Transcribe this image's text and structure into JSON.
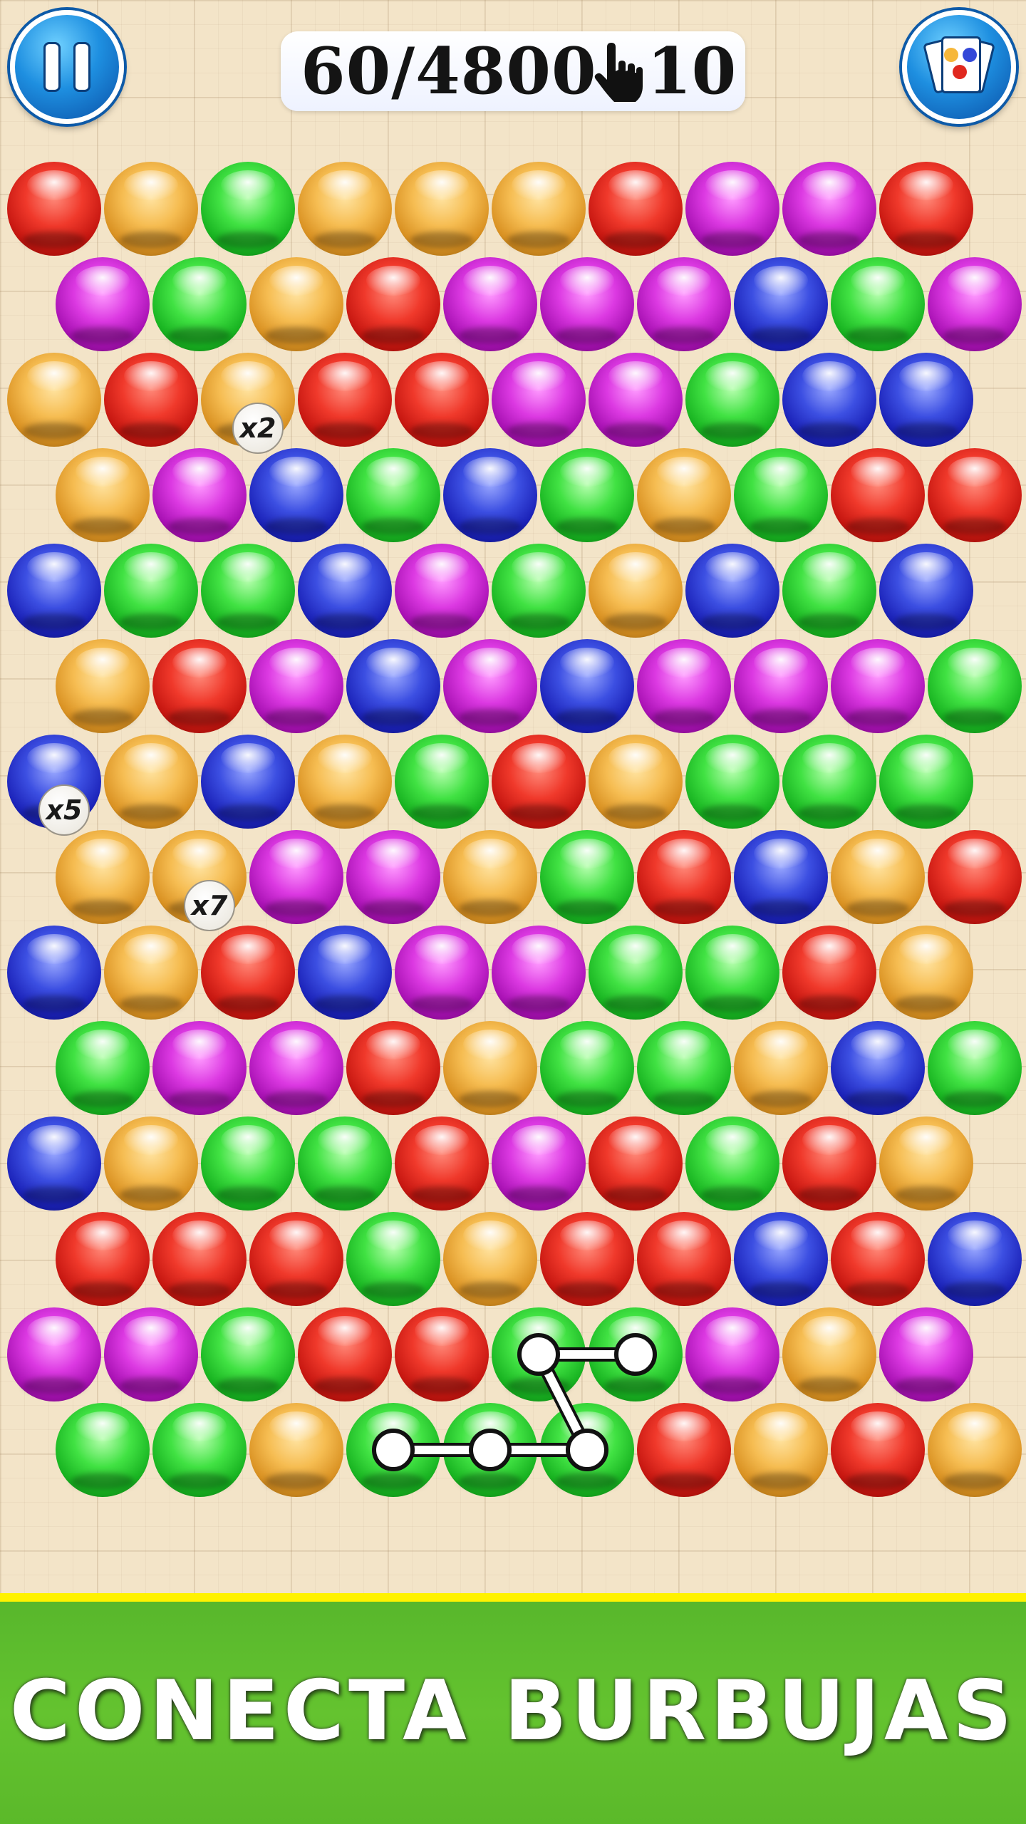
{
  "hud": {
    "score": "60/4800",
    "moves": "10",
    "pause_icon": "pause-icon",
    "hand_icon": "hand-pointer-icon",
    "cards_icon": "color-cards-icon"
  },
  "board": {
    "rows": [
      [
        "red",
        "orange",
        "green",
        "orange",
        "orange",
        "orange",
        "red",
        "purple",
        "purple",
        "red"
      ],
      [
        "purple",
        "green",
        "orange",
        "red",
        "purple",
        "purple",
        "purple",
        "blue",
        "green",
        "purple"
      ],
      [
        "orange",
        "red",
        "orange",
        "red",
        "red",
        "purple",
        "purple",
        "green",
        "blue",
        "blue"
      ],
      [
        "orange",
        "purple",
        "blue",
        "green",
        "blue",
        "green",
        "orange",
        "green",
        "red",
        "red"
      ],
      [
        "blue",
        "green",
        "green",
        "blue",
        "purple",
        "green",
        "orange",
        "blue",
        "green",
        "blue"
      ],
      [
        "orange",
        "red",
        "purple",
        "blue",
        "purple",
        "blue",
        "purple",
        "purple",
        "purple",
        "green"
      ],
      [
        "blue",
        "orange",
        "blue",
        "orange",
        "green",
        "red",
        "orange",
        "green",
        "green",
        "green"
      ],
      [
        "orange",
        "orange",
        "purple",
        "purple",
        "orange",
        "green",
        "red",
        "blue",
        "orange",
        "red"
      ],
      [
        "blue",
        "orange",
        "red",
        "blue",
        "purple",
        "purple",
        "green",
        "green",
        "red",
        "orange"
      ],
      [
        "green",
        "purple",
        "purple",
        "red",
        "orange",
        "green",
        "green",
        "orange",
        "blue",
        "green"
      ],
      [
        "blue",
        "orange",
        "green",
        "green",
        "red",
        "purple",
        "red",
        "green",
        "red",
        "orange"
      ],
      [
        "red",
        "red",
        "red",
        "green",
        "orange",
        "red",
        "red",
        "blue",
        "red",
        "blue"
      ],
      [
        "purple",
        "purple",
        "green",
        "red",
        "red",
        "green",
        "green",
        "purple",
        "orange",
        "purple"
      ],
      [
        "green",
        "green",
        "orange",
        "green",
        "green",
        "green",
        "red",
        "orange",
        "red",
        "orange"
      ]
    ],
    "multipliers": [
      {
        "row": 2,
        "col": 2,
        "label": "x2"
      },
      {
        "row": 6,
        "col": 0,
        "label": "x5"
      },
      {
        "row": 7,
        "col": 1,
        "label": "x7"
      }
    ],
    "selected_path": [
      {
        "row": 12,
        "col": 6
      },
      {
        "row": 12,
        "col": 5
      },
      {
        "row": 13,
        "col": 5
      },
      {
        "row": 13,
        "col": 4
      },
      {
        "row": 13,
        "col": 3
      }
    ]
  },
  "banner": {
    "text": "CONECTA BURBUJAS"
  },
  "colors": {
    "banner_green": "#5bb92a",
    "divider_yellow": "#fff200",
    "button_blue": "#1e8fe0"
  }
}
